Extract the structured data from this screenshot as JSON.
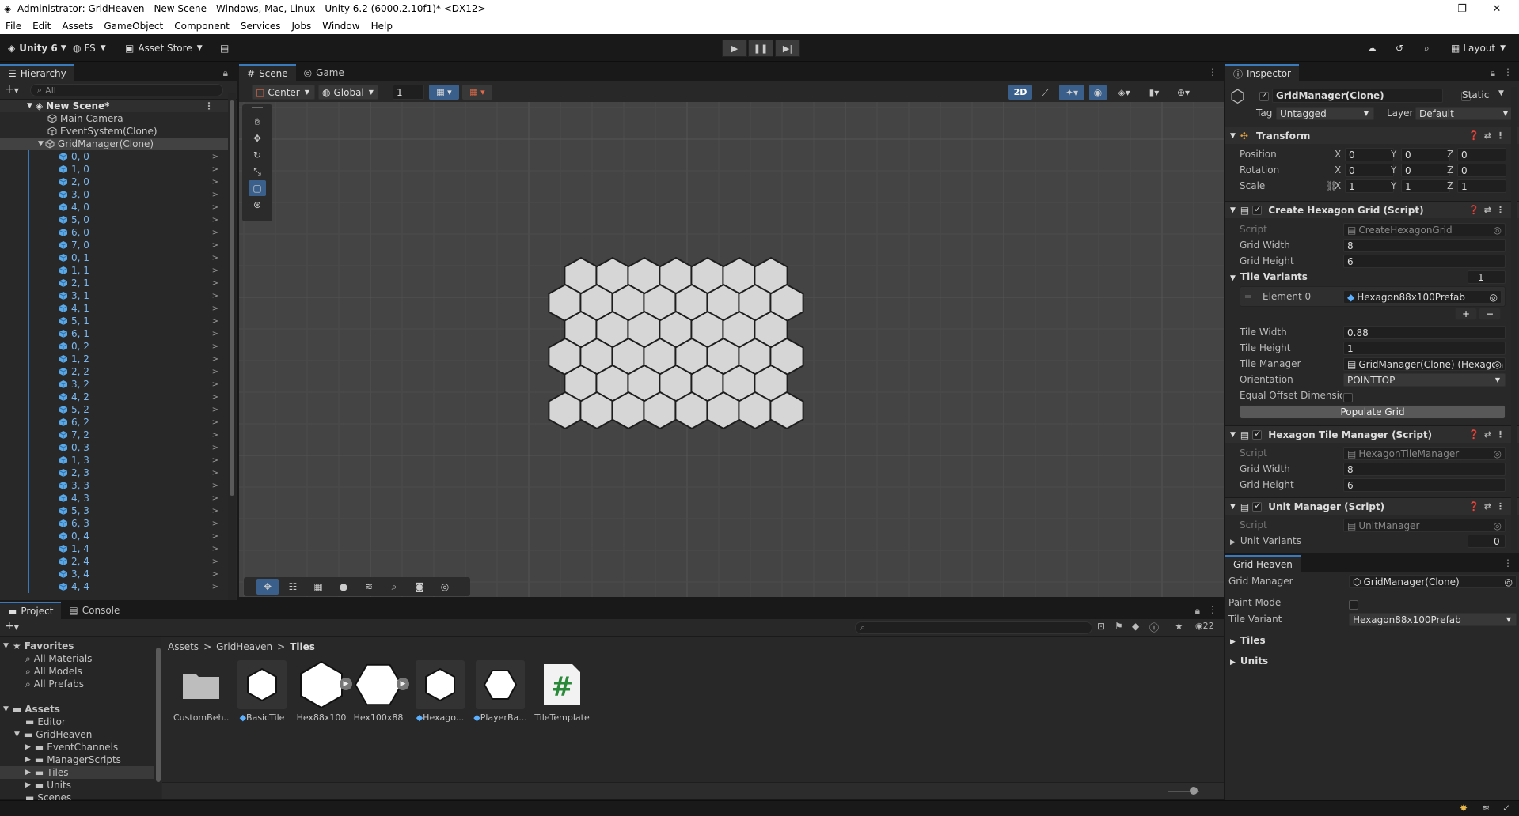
{
  "window": {
    "title": "Administrator: GridHeaven - New Scene - Windows, Mac, Linux - Unity 6.2 (6000.2.10f1)* <DX12>"
  },
  "menu": [
    "File",
    "Edit",
    "Assets",
    "GameObject",
    "Component",
    "Services",
    "Jobs",
    "Window",
    "Help"
  ],
  "toolbar": {
    "unity_label": "Unity 6",
    "fs_label": "FS",
    "asset_store_label": "Asset Store",
    "layout_label": "Layout"
  },
  "hierarchy": {
    "tab": "Hierarchy",
    "search_placeholder": "All",
    "scene": "New Scene*",
    "items": [
      "Main Camera",
      "EventSystem(Clone)",
      "GridManager(Clone)"
    ],
    "tiles": [
      "0, 0",
      "1, 0",
      "2, 0",
      "3, 0",
      "4, 0",
      "5, 0",
      "6, 0",
      "7, 0",
      "0, 1",
      "1, 1",
      "2, 1",
      "3, 1",
      "4, 1",
      "5, 1",
      "6, 1",
      "0, 2",
      "1, 2",
      "2, 2",
      "3, 2",
      "4, 2",
      "5, 2",
      "6, 2",
      "7, 2",
      "0, 3",
      "1, 3",
      "2, 3",
      "3, 3",
      "4, 3",
      "5, 3",
      "6, 3",
      "0, 4",
      "1, 4",
      "2, 4",
      "3, 4",
      "4, 4"
    ]
  },
  "scene": {
    "tabs": [
      "Scene",
      "Game"
    ],
    "pivot": "Center",
    "space": "Global",
    "snap_value": "1",
    "mode_2d": "2D"
  },
  "inspector": {
    "tab": "Inspector",
    "object_name": "GridManager(Clone)",
    "static_label": "Static",
    "tag_label": "Tag",
    "tag_value": "Untagged",
    "layer_label": "Layer",
    "layer_value": "Default",
    "transform": {
      "title": "Transform",
      "position_label": "Position",
      "rotation_label": "Rotation",
      "scale_label": "Scale",
      "position": [
        "0",
        "0",
        "0"
      ],
      "rotation": [
        "0",
        "0",
        "0"
      ],
      "scale": [
        "1",
        "1",
        "1"
      ],
      "axes": [
        "X",
        "Y",
        "Z"
      ]
    },
    "create_grid": {
      "title": "Create Hexagon Grid (Script)",
      "script_label": "Script",
      "script_value": "CreateHexagonGrid",
      "grid_width_label": "Grid Width",
      "grid_width": "8",
      "grid_height_label": "Grid Height",
      "grid_height": "6",
      "tile_variants_label": "Tile Variants",
      "tile_variants_count": "1",
      "element_label": "Element 0",
      "element_value": "Hexagon88x100Prefab",
      "tile_width_label": "Tile Width",
      "tile_width": "0.88",
      "tile_height_label": "Tile Height",
      "tile_height": "1",
      "tile_manager_label": "Tile Manager",
      "tile_manager": "GridManager(Clone) (Hexagon",
      "orientation_label": "Orientation",
      "orientation": "POINTTOP",
      "equal_offset_label": "Equal Offset Dimensior",
      "populate_button": "Populate Grid"
    },
    "tile_manager": {
      "title": "Hexagon Tile Manager (Script)",
      "script_label": "Script",
      "script_value": "HexagonTileManager",
      "grid_width_label": "Grid Width",
      "grid_width": "8",
      "grid_height_label": "Grid Height",
      "grid_height": "6"
    },
    "unit_manager": {
      "title": "Unit Manager (Script)",
      "script_label": "Script",
      "script_value": "UnitManager",
      "unit_variants_label": "Unit Variants",
      "unit_variants_count": "0"
    }
  },
  "grid_heaven": {
    "tab": "Grid Heaven",
    "grid_manager_label": "Grid Manager",
    "grid_manager_value": "GridManager(Clone)",
    "paint_mode_label": "Paint Mode",
    "tile_variant_label": "Tile Variant",
    "tile_variant_value": "Hexagon88x100Prefab",
    "tiles_label": "Tiles",
    "units_label": "Units"
  },
  "project": {
    "tabs": [
      "Project",
      "Console"
    ],
    "hidden_count": "22",
    "favorites_label": "Favorites",
    "favorites": [
      "All Materials",
      "All Models",
      "All Prefabs"
    ],
    "assets_label": "Assets",
    "tree": [
      "Editor",
      "GridHeaven",
      "EventChannels",
      "ManagerScripts",
      "Tiles",
      "Units",
      "Scenes"
    ],
    "breadcrumb": [
      "Assets",
      "GridHeaven",
      "Tiles"
    ],
    "items": [
      "CustomBeh...",
      "BasicTile",
      "Hex88x100",
      "Hex100x88",
      "Hexago...",
      "PlayerBa...",
      "TileTemplate"
    ]
  },
  "colors": {
    "accent": "#3a79bb",
    "panel": "#282828",
    "hex_fill": "#d6d6d6",
    "hex_outline": "#4a7ab0"
  }
}
